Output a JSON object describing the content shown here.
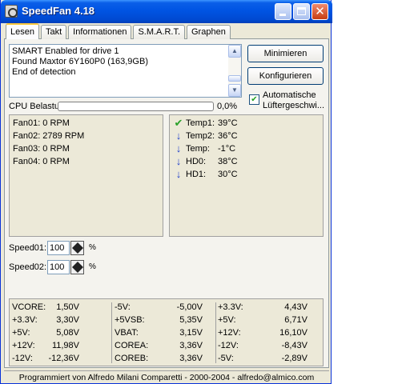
{
  "window": {
    "title": "SpeedFan 4.18"
  },
  "tabs": [
    {
      "label": "Lesen",
      "active": true
    },
    {
      "label": "Takt"
    },
    {
      "label": "Informationen"
    },
    {
      "label": "S.M.A.R.T."
    },
    {
      "label": "Graphen"
    }
  ],
  "log": {
    "lines": [
      "SMART Enabled for drive 1",
      "Found Maxtor 6Y160P0 (163,9GB)",
      "End of detection"
    ]
  },
  "buttons": {
    "minimize": "Minimieren",
    "configure": "Konfigurieren"
  },
  "auto_fan": {
    "label_line1": "Automatische",
    "label_line2": "Lüftergeschwi...",
    "checked": true
  },
  "cpu": {
    "label": "CPU Belastu",
    "percent_text": "0,0%",
    "usage": 0.0
  },
  "fans": [
    "Fan01: 0 RPM",
    "Fan02: 2789 RPM",
    "Fan03: 0 RPM",
    "Fan04: 0 RPM"
  ],
  "temps": [
    {
      "icon": "checkmark-icon",
      "name": "Temp1:",
      "value": "39°C"
    },
    {
      "icon": "down-arrow-icon",
      "name": "Temp2:",
      "value": "36°C"
    },
    {
      "icon": "down-arrow-icon",
      "name": "Temp:",
      "value": "-1°C"
    },
    {
      "icon": "down-arrow-icon",
      "name": "HD0:",
      "value": "38°C"
    },
    {
      "icon": "down-arrow-icon",
      "name": "HD1:",
      "value": "30°C"
    }
  ],
  "speeds": [
    {
      "label": "Speed01:",
      "value": "100",
      "unit": "%"
    },
    {
      "label": "Speed02:",
      "value": "100",
      "unit": "%"
    }
  ],
  "voltages": {
    "col1": [
      {
        "name": "VCORE:",
        "value": "1,50V"
      },
      {
        "name": "+3.3V:",
        "value": "3,30V"
      },
      {
        "name": "+5V:",
        "value": "5,08V"
      },
      {
        "name": "+12V:",
        "value": "11,98V"
      },
      {
        "name": "-12V:",
        "value": "-12,36V"
      }
    ],
    "col2": [
      {
        "name": "-5V:",
        "value": "-5,00V"
      },
      {
        "name": "+5VSB:",
        "value": "5,35V"
      },
      {
        "name": "VBAT:",
        "value": "3,15V"
      },
      {
        "name": "COREA:",
        "value": "3,36V"
      },
      {
        "name": "COREB:",
        "value": "3,36V"
      }
    ],
    "col3": [
      {
        "name": "+3.3V:",
        "value": "4,43V"
      },
      {
        "name": "+5V:",
        "value": "6,71V"
      },
      {
        "name": "+12V:",
        "value": "16,10V"
      },
      {
        "name": "-12V:",
        "value": "-8,43V"
      },
      {
        "name": "-5V:",
        "value": "-2,89V"
      }
    ]
  },
  "statusbar": {
    "text": "Programmiert von Alfredo Milani Comparetti - 2000-2004 - alfredo@almico.com"
  },
  "colors": {
    "accent": "#0054e3",
    "ok": "#2aa12a",
    "down_arrow": "#1f3ec9",
    "cpu_bar": "#2fb72f"
  }
}
